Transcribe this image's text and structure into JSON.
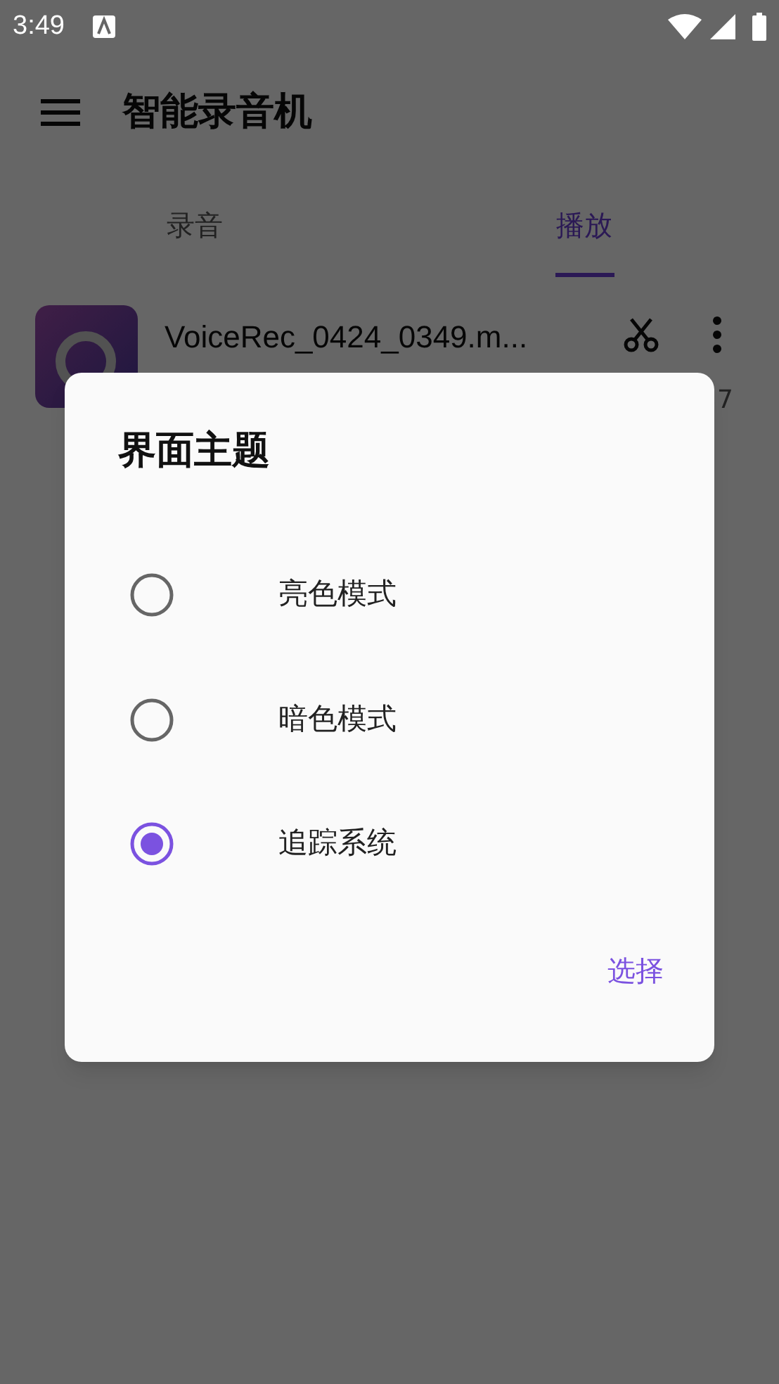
{
  "status_bar": {
    "time": "3:49"
  },
  "toolbar": {
    "title": "智能录音机"
  },
  "tabs": [
    {
      "label": "录音",
      "selected": false
    },
    {
      "label": "播放",
      "selected": true
    }
  ],
  "recordings": [
    {
      "name": "VoiceRec_0424_0349.m...",
      "detail": "7"
    }
  ],
  "dialog": {
    "title": "界面主题",
    "options": [
      {
        "label": "亮色模式",
        "selected": false
      },
      {
        "label": "暗色模式",
        "selected": false
      },
      {
        "label": "追踪系统",
        "selected": true
      }
    ],
    "button": "选择"
  }
}
